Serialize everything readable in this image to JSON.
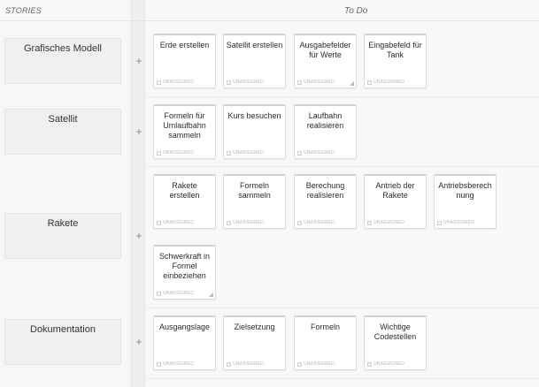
{
  "header": {
    "stories": "STORIES",
    "todo": "To Do"
  },
  "add_label": "+",
  "status_label": "UNASSIGNED",
  "stories": [
    {
      "title": "Grafisches Modell"
    },
    {
      "title": "Satellit"
    },
    {
      "title": "Rakete"
    },
    {
      "title": "Dokumentation"
    }
  ],
  "tasks": {
    "grafisches_modell": [
      {
        "title": "Erde erstellen"
      },
      {
        "title": "Satellit erstellen"
      },
      {
        "title": "Ausgabefelder für Werte"
      },
      {
        "title": "Eingabefeld für Tank"
      }
    ],
    "satellit": [
      {
        "title": "Formeln für Umlaufbahn sammeln"
      },
      {
        "title": "Kurs besuchen"
      },
      {
        "title": "Laufbahn realisieren"
      }
    ],
    "rakete": [
      {
        "title": "Rakete erstellen"
      },
      {
        "title": "Formeln sammeln"
      },
      {
        "title": "Berechung realisieren"
      },
      {
        "title": "Antrieb der Rakete"
      },
      {
        "title": "Antriebsberechnung"
      },
      {
        "title": "Schwerkraft in Formel einbeziehen"
      }
    ],
    "dokumentation": [
      {
        "title": "Ausgangslage"
      },
      {
        "title": "Zielsetzung"
      },
      {
        "title": "Formeln"
      },
      {
        "title": "Wichtige Codestellen"
      }
    ]
  }
}
